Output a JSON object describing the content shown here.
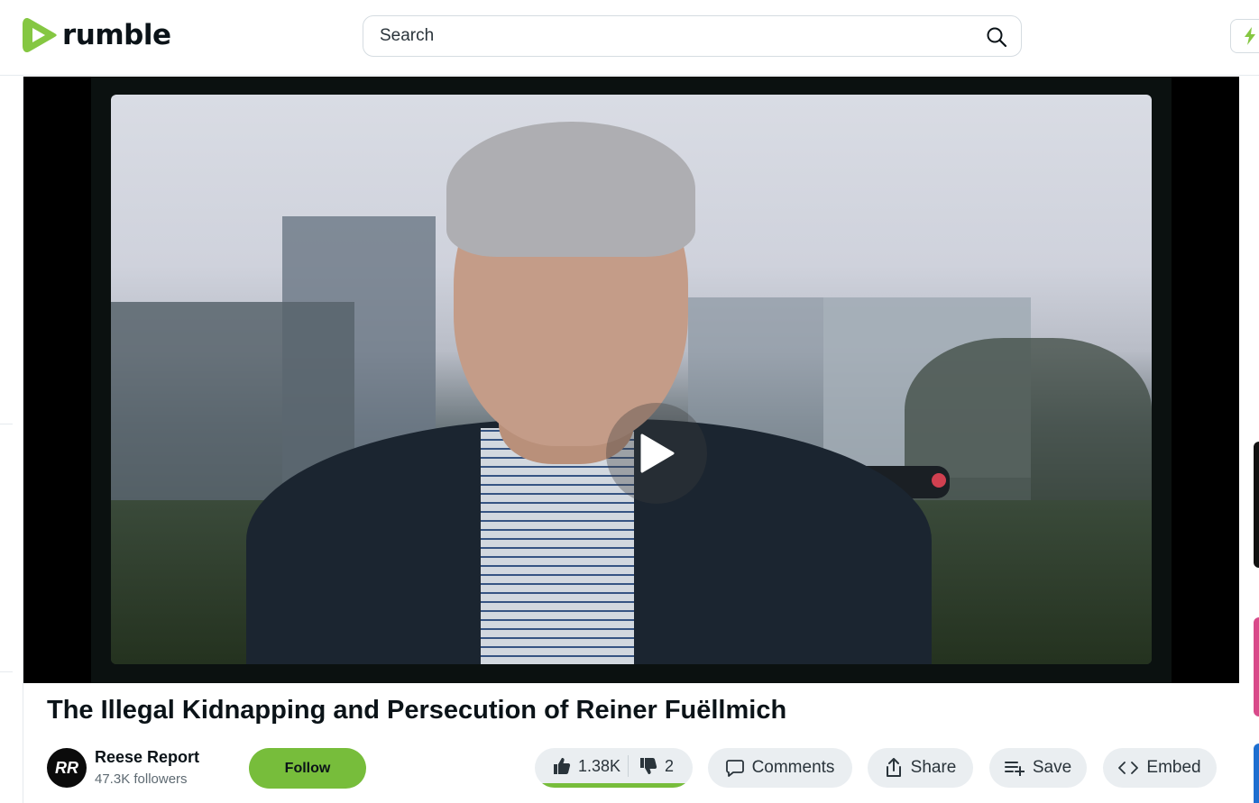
{
  "brand": {
    "name": "rumble",
    "logo_color": "#85c742"
  },
  "search": {
    "placeholder": "Search",
    "value": "",
    "icon": "search-icon"
  },
  "header": {
    "upgrade_icon": "lightning-icon"
  },
  "video": {
    "title": "The Illegal Kidnapping and Persecution of Reiner Fuëllmich",
    "play_icon": "play-icon"
  },
  "channel": {
    "name": "Reese Report",
    "followers": "47.3K followers",
    "avatar_initials": "RR",
    "follow_label": "Follow"
  },
  "actions": {
    "likes": "1.38K",
    "dislikes": "2",
    "like_ratio": 0.99,
    "comments_label": "Comments",
    "share_label": "Share",
    "save_label": "Save",
    "embed_label": "Embed"
  },
  "colors": {
    "accent": "#85c742",
    "follow_bg": "#77bd3b",
    "pill_bg": "#eaeef1"
  }
}
